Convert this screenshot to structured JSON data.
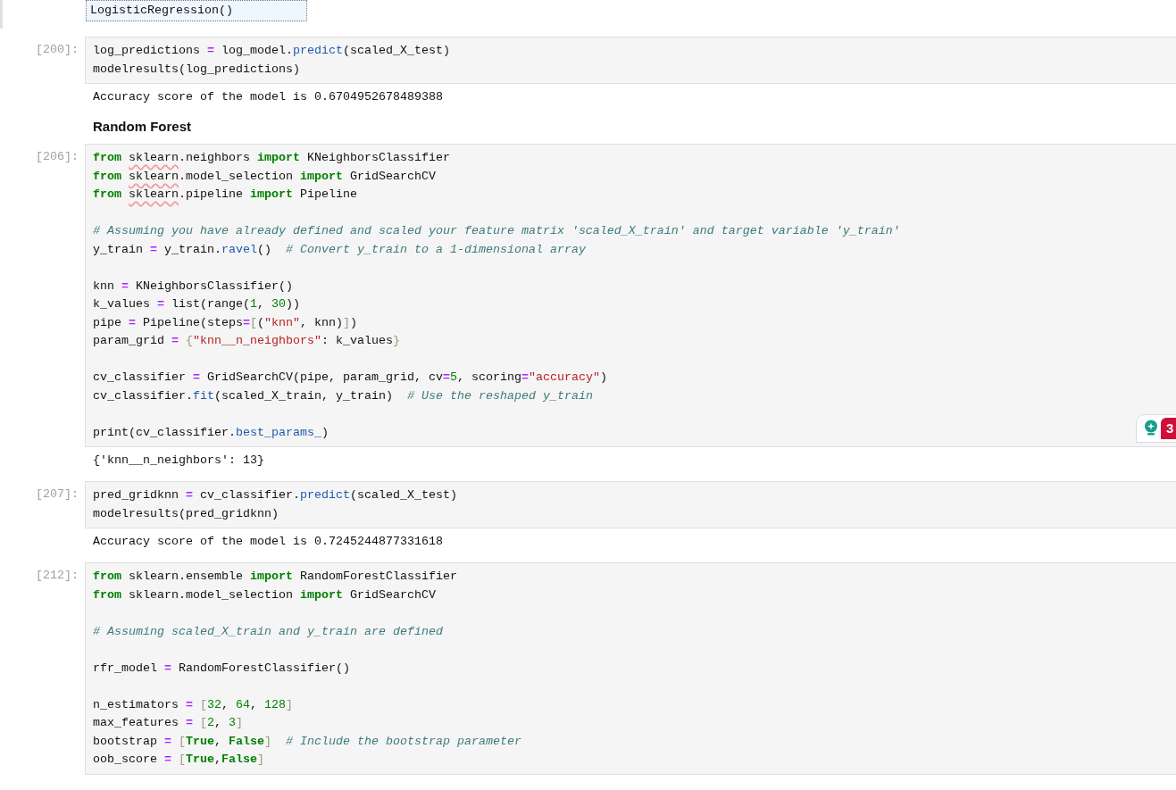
{
  "top_output": {
    "text": "LogisticRegression()"
  },
  "cells": [
    {
      "kind": "code",
      "prompt": "[200]:",
      "lines": [
        {
          "kind": "code",
          "tokens": [
            {
              "kind": "name",
              "text": "log_predictions "
            },
            {
              "kind": "op",
              "text": "="
            },
            {
              "kind": "name",
              "text": " log_model."
            },
            {
              "kind": "prop",
              "text": "predict"
            },
            {
              "kind": "name",
              "text": "(scaled_X_test)"
            }
          ]
        },
        {
          "kind": "code",
          "tokens": [
            {
              "kind": "name",
              "text": "modelresults(log_predictions)"
            }
          ]
        }
      ],
      "output": "Accuracy score of the model is 0.6704952678489388"
    },
    {
      "kind": "markdown",
      "heading": "Random Forest"
    },
    {
      "kind": "code",
      "prompt": "[206]:",
      "lines": [
        {
          "kind": "code",
          "tokens": [
            {
              "kind": "kw",
              "text": "from "
            },
            {
              "kind": "flag",
              "text": "sklearn"
            },
            {
              "kind": "name",
              "text": ".neighbors "
            },
            {
              "kind": "kw",
              "text": "import"
            },
            {
              "kind": "name",
              "text": " KNeighborsClassifier"
            }
          ]
        },
        {
          "kind": "code",
          "tokens": [
            {
              "kind": "kw",
              "text": "from "
            },
            {
              "kind": "flag",
              "text": "sklearn"
            },
            {
              "kind": "name",
              "text": ".model_selection "
            },
            {
              "kind": "kw",
              "text": "import"
            },
            {
              "kind": "name",
              "text": " GridSearchCV"
            }
          ]
        },
        {
          "kind": "code",
          "tokens": [
            {
              "kind": "kw",
              "text": "from "
            },
            {
              "kind": "flag",
              "text": "sklearn"
            },
            {
              "kind": "name",
              "text": ".pipeline "
            },
            {
              "kind": "kw",
              "text": "import"
            },
            {
              "kind": "name",
              "text": " Pipeline"
            }
          ]
        },
        {
          "kind": "blank"
        },
        {
          "kind": "code",
          "tokens": [
            {
              "kind": "com",
              "text": "# Assuming you have already defined and scaled your feature matrix 'scaled_X_train' and target variable 'y_train'"
            }
          ]
        },
        {
          "kind": "code",
          "tokens": [
            {
              "kind": "name",
              "text": "y_train "
            },
            {
              "kind": "op",
              "text": "="
            },
            {
              "kind": "name",
              "text": " y_train."
            },
            {
              "kind": "prop",
              "text": "ravel"
            },
            {
              "kind": "name",
              "text": "()  "
            },
            {
              "kind": "com",
              "text": "# Convert y_train to a 1-dimensional array"
            }
          ]
        },
        {
          "kind": "blank"
        },
        {
          "kind": "code",
          "tokens": [
            {
              "kind": "name",
              "text": "knn "
            },
            {
              "kind": "op",
              "text": "="
            },
            {
              "kind": "name",
              "text": " KNeighborsClassifier()"
            }
          ]
        },
        {
          "kind": "code",
          "tokens": [
            {
              "kind": "name",
              "text": "k_values "
            },
            {
              "kind": "op",
              "text": "="
            },
            {
              "kind": "name",
              "text": " list(range("
            },
            {
              "kind": "num",
              "text": "1"
            },
            {
              "kind": "name",
              "text": ", "
            },
            {
              "kind": "num",
              "text": "30"
            },
            {
              "kind": "name",
              "text": "))"
            }
          ]
        },
        {
          "kind": "code",
          "tokens": [
            {
              "kind": "name",
              "text": "pipe "
            },
            {
              "kind": "op",
              "text": "="
            },
            {
              "kind": "name",
              "text": " Pipeline(steps"
            },
            {
              "kind": "op",
              "text": "="
            },
            {
              "kind": "br",
              "text": "["
            },
            {
              "kind": "name",
              "text": "("
            },
            {
              "kind": "str",
              "text": "\"knn\""
            },
            {
              "kind": "name",
              "text": ", knn)"
            },
            {
              "kind": "br",
              "text": "]"
            },
            {
              "kind": "name",
              "text": ")"
            }
          ]
        },
        {
          "kind": "code",
          "tokens": [
            {
              "kind": "name",
              "text": "param_grid "
            },
            {
              "kind": "op",
              "text": "= "
            },
            {
              "kind": "br",
              "text": "{"
            },
            {
              "kind": "str",
              "text": "\"knn__n_neighbors\""
            },
            {
              "kind": "name",
              "text": ": k_values"
            },
            {
              "kind": "br",
              "text": "}"
            }
          ]
        },
        {
          "kind": "blank"
        },
        {
          "kind": "code",
          "tokens": [
            {
              "kind": "name",
              "text": "cv_classifier "
            },
            {
              "kind": "op",
              "text": "="
            },
            {
              "kind": "name",
              "text": " GridSearchCV(pipe, param_grid, cv"
            },
            {
              "kind": "op",
              "text": "="
            },
            {
              "kind": "num",
              "text": "5"
            },
            {
              "kind": "name",
              "text": ", scoring"
            },
            {
              "kind": "op",
              "text": "="
            },
            {
              "kind": "str",
              "text": "\"accuracy\""
            },
            {
              "kind": "name",
              "text": ")"
            }
          ]
        },
        {
          "kind": "code",
          "tokens": [
            {
              "kind": "name",
              "text": "cv_classifier."
            },
            {
              "kind": "prop",
              "text": "fit"
            },
            {
              "kind": "name",
              "text": "(scaled_X_train, y_train)  "
            },
            {
              "kind": "com",
              "text": "# Use the reshaped y_train"
            }
          ]
        },
        {
          "kind": "blank"
        },
        {
          "kind": "code",
          "tokens": [
            {
              "kind": "name",
              "text": "print(cv_classifier."
            },
            {
              "kind": "prop",
              "text": "best_params_"
            },
            {
              "kind": "name",
              "text": ")"
            }
          ]
        }
      ],
      "hint": {
        "count": "3"
      },
      "output": "{'knn__n_neighbors': 13}"
    },
    {
      "kind": "code",
      "prompt": "[207]:",
      "lines": [
        {
          "kind": "code",
          "tokens": [
            {
              "kind": "name",
              "text": "pred_gridknn "
            },
            {
              "kind": "op",
              "text": "="
            },
            {
              "kind": "name",
              "text": " cv_classifier."
            },
            {
              "kind": "prop",
              "text": "predict"
            },
            {
              "kind": "name",
              "text": "(scaled_X_test)"
            }
          ]
        },
        {
          "kind": "code",
          "tokens": [
            {
              "kind": "name",
              "text": "modelresults(pred_gridknn)"
            }
          ]
        }
      ],
      "output": "Accuracy score of the model is 0.7245244877331618"
    },
    {
      "kind": "code",
      "prompt": "[212]:",
      "lines": [
        {
          "kind": "code",
          "tokens": [
            {
              "kind": "kw",
              "text": "from"
            },
            {
              "kind": "name",
              "text": " sklearn.ensemble "
            },
            {
              "kind": "kw",
              "text": "import"
            },
            {
              "kind": "name",
              "text": " RandomForestClassifier"
            }
          ]
        },
        {
          "kind": "code",
          "tokens": [
            {
              "kind": "kw",
              "text": "from"
            },
            {
              "kind": "name",
              "text": " sklearn.model_selection "
            },
            {
              "kind": "kw",
              "text": "import"
            },
            {
              "kind": "name",
              "text": " GridSearchCV"
            }
          ]
        },
        {
          "kind": "blank"
        },
        {
          "kind": "code",
          "tokens": [
            {
              "kind": "com",
              "text": "# Assuming scaled_X_train and y_train are defined"
            }
          ]
        },
        {
          "kind": "blank"
        },
        {
          "kind": "code",
          "tokens": [
            {
              "kind": "name",
              "text": "rfr_model "
            },
            {
              "kind": "op",
              "text": "="
            },
            {
              "kind": "name",
              "text": " RandomForestClassifier()"
            }
          ]
        },
        {
          "kind": "blank"
        },
        {
          "kind": "code",
          "tokens": [
            {
              "kind": "name",
              "text": "n_estimators "
            },
            {
              "kind": "op",
              "text": "= "
            },
            {
              "kind": "br",
              "text": "["
            },
            {
              "kind": "num",
              "text": "32"
            },
            {
              "kind": "name",
              "text": ", "
            },
            {
              "kind": "num",
              "text": "64"
            },
            {
              "kind": "name",
              "text": ", "
            },
            {
              "kind": "num",
              "text": "128"
            },
            {
              "kind": "br",
              "text": "]"
            }
          ]
        },
        {
          "kind": "code",
          "tokens": [
            {
              "kind": "name",
              "text": "max_features "
            },
            {
              "kind": "op",
              "text": "= "
            },
            {
              "kind": "br",
              "text": "["
            },
            {
              "kind": "num",
              "text": "2"
            },
            {
              "kind": "name",
              "text": ", "
            },
            {
              "kind": "num",
              "text": "3"
            },
            {
              "kind": "br",
              "text": "]"
            }
          ]
        },
        {
          "kind": "code",
          "tokens": [
            {
              "kind": "name",
              "text": "bootstrap "
            },
            {
              "kind": "op",
              "text": "= "
            },
            {
              "kind": "br",
              "text": "["
            },
            {
              "kind": "bool",
              "text": "True"
            },
            {
              "kind": "name",
              "text": ", "
            },
            {
              "kind": "bool",
              "text": "False"
            },
            {
              "kind": "br",
              "text": "]"
            },
            {
              "kind": "com",
              "text": "  # Include the bootstrap parameter"
            }
          ]
        },
        {
          "kind": "code",
          "tokens": [
            {
              "kind": "name",
              "text": "oob_score "
            },
            {
              "kind": "op",
              "text": "= "
            },
            {
              "kind": "br",
              "text": "["
            },
            {
              "kind": "bool",
              "text": "True"
            },
            {
              "kind": "name",
              "text": ","
            },
            {
              "kind": "bool",
              "text": "False"
            },
            {
              "kind": "br",
              "text": "]"
            }
          ]
        }
      ]
    }
  ]
}
